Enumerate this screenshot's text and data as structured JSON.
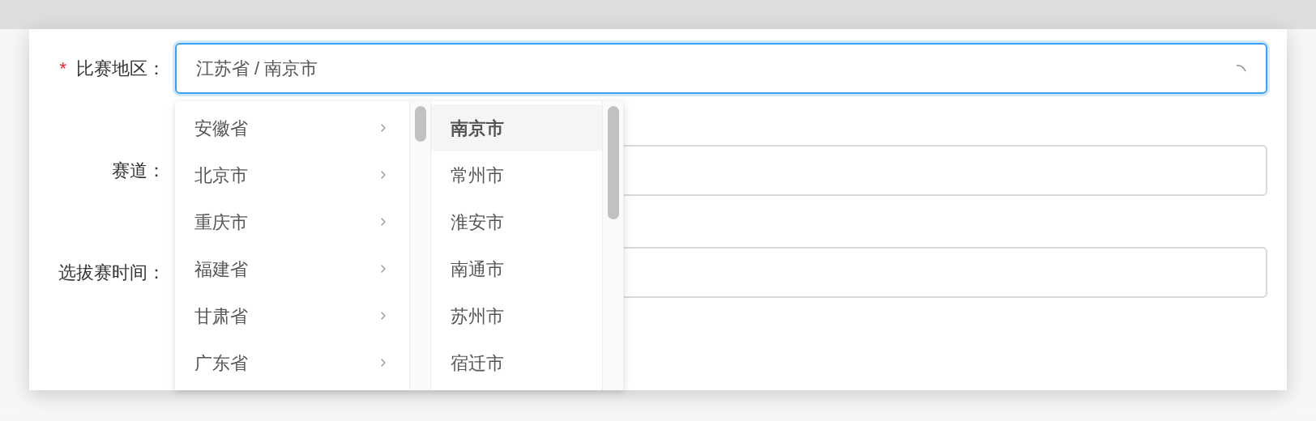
{
  "form": {
    "fields": [
      {
        "label": "比赛地区：",
        "required_mark": "*",
        "value": "江苏省 / 南京市",
        "focused": true,
        "loading": true
      },
      {
        "label": "赛道：",
        "focused": false,
        "loading": false
      },
      {
        "label": "选拔赛时间：",
        "focused": false,
        "loading": false
      }
    ]
  },
  "cascader": {
    "columns": [
      {
        "items": [
          {
            "label": "安徽省",
            "selected": false
          },
          {
            "label": "北京市",
            "selected": false
          },
          {
            "label": "重庆市",
            "selected": false
          },
          {
            "label": "福建省",
            "selected": false
          },
          {
            "label": "甘肃省",
            "selected": false
          },
          {
            "label": "广东省",
            "selected": false
          }
        ],
        "has_children": true
      },
      {
        "items": [
          {
            "label": "南京市",
            "selected": true
          },
          {
            "label": "常州市",
            "selected": false
          },
          {
            "label": "淮安市",
            "selected": false
          },
          {
            "label": "南通市",
            "selected": false
          },
          {
            "label": "苏州市",
            "selected": false
          },
          {
            "label": "宿迁市",
            "selected": false
          }
        ],
        "has_children": false
      }
    ]
  }
}
